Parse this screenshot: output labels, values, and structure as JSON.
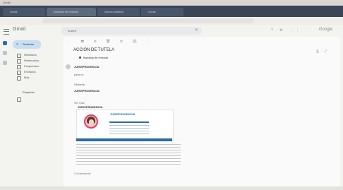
{
  "browser": {
    "window_title": "Gmail",
    "tabs": [
      "Gmail",
      "Bandeja de entrada",
      "Nueva pestaña",
      "Gmail"
    ]
  },
  "header": {
    "app_name": "Gmail",
    "search_query": "in:sent",
    "brand": "Google"
  },
  "sidebar": {
    "compose_label": "Redactar",
    "items": [
      "Recibidos",
      "Destacados",
      "Pospuestos",
      "Enviados",
      "Más"
    ],
    "labels_heading": "Etiquetas"
  },
  "message": {
    "subject": "ACCIÓN DE TUTELA",
    "label": "Bandeja de entrada",
    "sender": "JURISPRUDENCIA",
    "to": "para mí",
    "greeting": "Señores",
    "body_lead": "JURISPRUDENCIA:",
    "link_text": "Ver más",
    "section_title": "JURISPRUDENCIA",
    "card_title": "JURISPRUDENCIA",
    "signature": "Cordialmente"
  }
}
